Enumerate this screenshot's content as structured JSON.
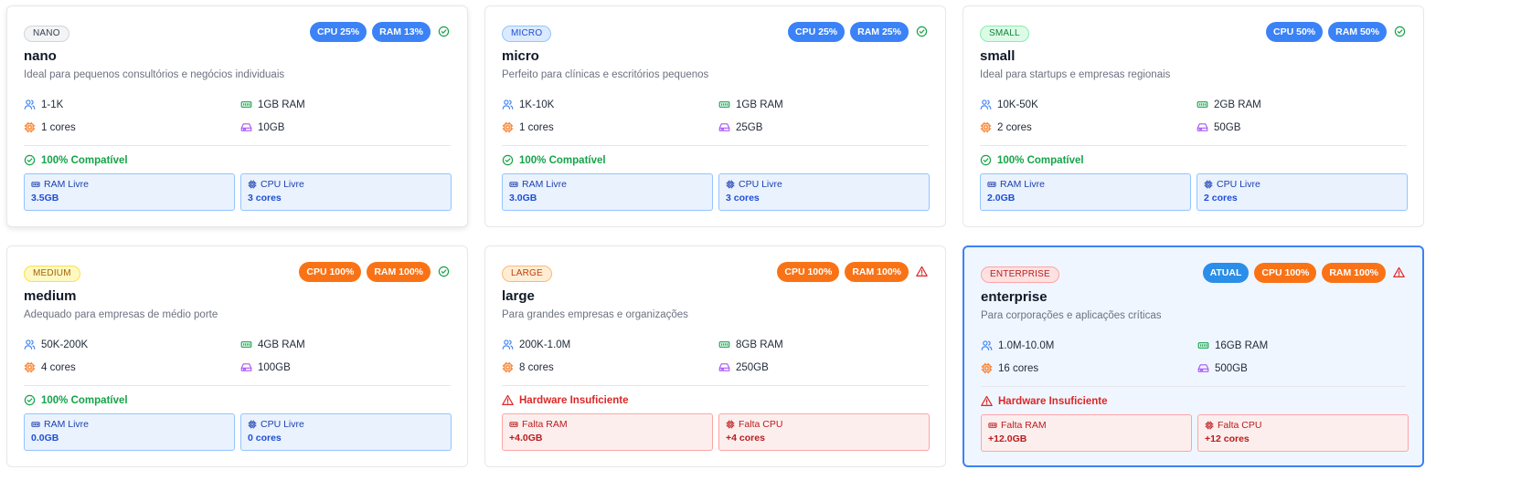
{
  "plans": [
    {
      "tier": "NANO",
      "tier_color": "gray",
      "name": "nano",
      "description": "Ideal para pequenos consultórios e negócios individuais",
      "current": false,
      "current_label": "",
      "cpu_badge": "CPU 25%",
      "cpu_badge_color": "blue",
      "ram_badge": "RAM 13%",
      "ram_badge_color": "blue",
      "status": "ok",
      "users": "1-1K",
      "ram": "1GB RAM",
      "cores": "1 cores",
      "storage": "10GB",
      "compat_label": "100% Compatível",
      "box1_label": "RAM Livre",
      "box1_value": "3.5GB",
      "box2_label": "CPU Livre",
      "box2_value": "3 cores"
    },
    {
      "tier": "MICRO",
      "tier_color": "blue",
      "name": "micro",
      "description": "Perfeito para clínicas e escritórios pequenos",
      "current": false,
      "current_label": "",
      "cpu_badge": "CPU 25%",
      "cpu_badge_color": "blue",
      "ram_badge": "RAM 25%",
      "ram_badge_color": "blue",
      "status": "ok",
      "users": "1K-10K",
      "ram": "1GB RAM",
      "cores": "1 cores",
      "storage": "25GB",
      "compat_label": "100% Compatível",
      "box1_label": "RAM Livre",
      "box1_value": "3.0GB",
      "box2_label": "CPU Livre",
      "box2_value": "3 cores"
    },
    {
      "tier": "SMALL",
      "tier_color": "green",
      "name": "small",
      "description": "Ideal para startups e empresas regionais",
      "current": false,
      "current_label": "",
      "cpu_badge": "CPU 50%",
      "cpu_badge_color": "blue",
      "ram_badge": "RAM 50%",
      "ram_badge_color": "blue",
      "status": "ok",
      "users": "10K-50K",
      "ram": "2GB RAM",
      "cores": "2 cores",
      "storage": "50GB",
      "compat_label": "100% Compatível",
      "box1_label": "RAM Livre",
      "box1_value": "2.0GB",
      "box2_label": "CPU Livre",
      "box2_value": "2 cores"
    },
    {
      "tier": "MEDIUM",
      "tier_color": "yellow",
      "name": "medium",
      "description": "Adequado para empresas de médio porte",
      "current": false,
      "current_label": "",
      "cpu_badge": "CPU 100%",
      "cpu_badge_color": "orange",
      "ram_badge": "RAM 100%",
      "ram_badge_color": "orange",
      "status": "ok",
      "users": "50K-200K",
      "ram": "4GB RAM",
      "cores": "4 cores",
      "storage": "100GB",
      "compat_label": "100% Compatível",
      "box1_label": "RAM Livre",
      "box1_value": "0.0GB",
      "box2_label": "CPU Livre",
      "box2_value": "0 cores"
    },
    {
      "tier": "LARGE",
      "tier_color": "orange",
      "name": "large",
      "description": "Para grandes empresas e organizações",
      "current": false,
      "current_label": "",
      "cpu_badge": "CPU 100%",
      "cpu_badge_color": "orange",
      "ram_badge": "RAM 100%",
      "ram_badge_color": "orange",
      "status": "bad",
      "users": "200K-1.0M",
      "ram": "8GB RAM",
      "cores": "8 cores",
      "storage": "250GB",
      "compat_label": "Hardware Insuficiente",
      "box1_label": "Falta RAM",
      "box1_value": "+4.0GB",
      "box2_label": "Falta CPU",
      "box2_value": "+4 cores"
    },
    {
      "tier": "ENTERPRISE",
      "tier_color": "red",
      "name": "enterprise",
      "description": "Para corporações e aplicações críticas",
      "current": true,
      "current_label": "ATUAL",
      "cpu_badge": "CPU 100%",
      "cpu_badge_color": "orange",
      "ram_badge": "RAM 100%",
      "ram_badge_color": "orange",
      "status": "bad",
      "users": "1.0M-10.0M",
      "ram": "16GB RAM",
      "cores": "16 cores",
      "storage": "500GB",
      "compat_label": "Hardware Insuficiente",
      "box1_label": "Falta RAM",
      "box1_value": "+12.0GB",
      "box2_label": "Falta CPU",
      "box2_value": "+12 cores"
    }
  ],
  "colors": {
    "ok": "#16a34a",
    "bad": "#dc2626",
    "badge_blue": "#3b82f6",
    "badge_orange": "#f97316",
    "badge_current": "#2b8ee8",
    "users_icon": "#3b82f6",
    "ram_icon": "#16a34a",
    "cpu_icon": "#f97316",
    "storage_icon": "#a855f7"
  },
  "icons": {
    "users": "users-icon",
    "ram": "memory-icon",
    "cpu": "cpu-icon",
    "storage": "hard-drive-icon",
    "ok": "check-circle-icon",
    "bad": "alert-triangle-icon"
  }
}
